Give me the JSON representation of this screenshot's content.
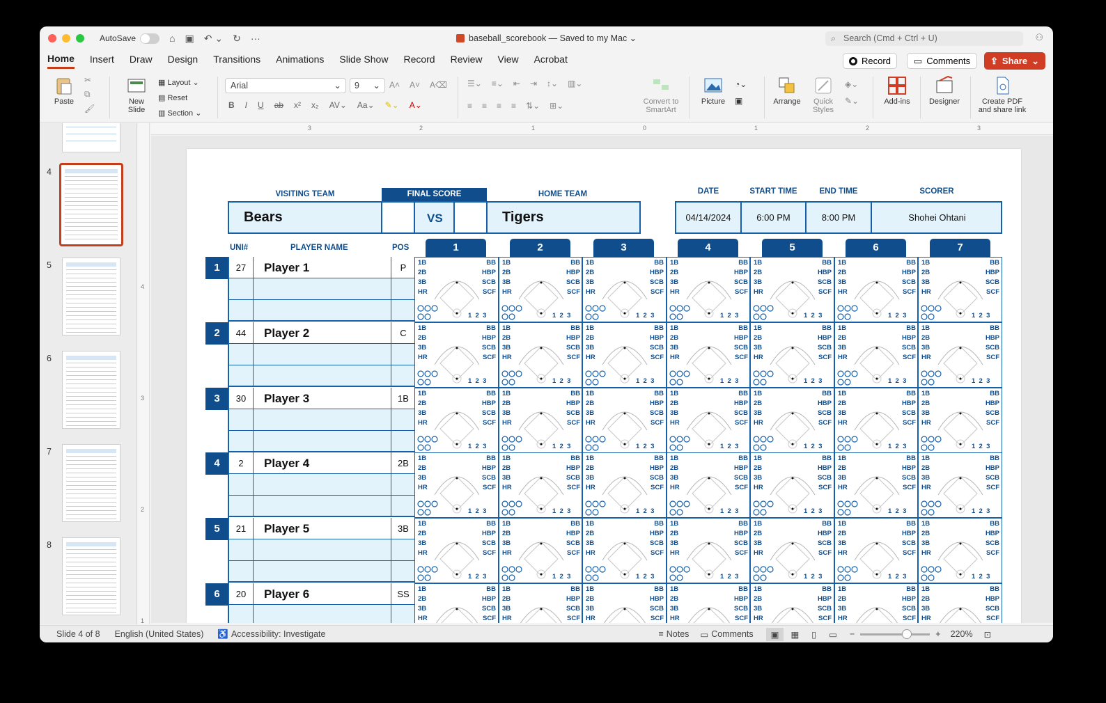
{
  "window": {
    "autosave_label": "AutoSave",
    "doc_title": "baseball_scorebook — Saved to my Mac ⌄",
    "search_placeholder": "Search (Cmd + Ctrl + U)"
  },
  "menu": {
    "tabs": [
      "Home",
      "Insert",
      "Draw",
      "Design",
      "Transitions",
      "Animations",
      "Slide Show",
      "Record",
      "Review",
      "View",
      "Acrobat"
    ],
    "record_label": "Record",
    "comments_label": "Comments",
    "share_label": "Share"
  },
  "ribbon": {
    "paste": "Paste",
    "new_slide": "New\nSlide",
    "layout": "Layout",
    "reset": "Reset",
    "section": "Section",
    "font": "Arial",
    "size": "9",
    "convert_smartart": "Convert to\nSmartArt",
    "picture": "Picture",
    "arrange": "Arrange",
    "quick_styles": "Quick\nStyles",
    "addins": "Add-ins",
    "designer": "Designer",
    "create_pdf": "Create PDF\nand share link"
  },
  "thumbs": [
    {
      "num": "4"
    },
    {
      "num": "5"
    },
    {
      "num": "6"
    },
    {
      "num": "7"
    },
    {
      "num": "8"
    }
  ],
  "ruler": {
    "h": [
      "3",
      "2",
      "1",
      "0",
      "1",
      "2",
      "3"
    ],
    "v": [
      "4",
      "3",
      "2",
      "1"
    ]
  },
  "scorebook": {
    "visiting_label": "VISITING TEAM",
    "final_score_label": "FINAL SCORE",
    "home_label": "HOME TEAM",
    "visiting_team": "Bears",
    "vs": "VS",
    "home_team": "Tigers",
    "date_label": "DATE",
    "start_label": "START TIME",
    "end_label": "END TIME",
    "scorer_label": "SCORER",
    "date": "04/14/2024",
    "start_time": "6:00 PM",
    "end_time": "8:00 PM",
    "scorer": "Shohei Ohtani",
    "uni_label": "UNI#",
    "player_label": "PLAYER NAME",
    "pos_label": "POS",
    "innings": [
      "1",
      "2",
      "3",
      "4",
      "5",
      "6",
      "7"
    ],
    "players": [
      {
        "order": "1",
        "uni": "27",
        "name": "Player 1",
        "pos": "P"
      },
      {
        "order": "2",
        "uni": "44",
        "name": "Player 2",
        "pos": "C"
      },
      {
        "order": "3",
        "uni": "30",
        "name": "Player 3",
        "pos": "1B"
      },
      {
        "order": "4",
        "uni": "2",
        "name": "Player 4",
        "pos": "2B"
      },
      {
        "order": "5",
        "uni": "21",
        "name": "Player 5",
        "pos": "3B"
      },
      {
        "order": "6",
        "uni": "20",
        "name": "Player 6",
        "pos": "SS"
      }
    ],
    "cell_left": [
      "1B",
      "2B",
      "3B",
      "HR"
    ],
    "cell_right": [
      "BB",
      "HBP",
      "SCB",
      "SCF"
    ],
    "cell_outs": "1  2  3"
  },
  "status": {
    "slide": "Slide 4 of 8",
    "language": "English (United States)",
    "accessibility": "Accessibility: Investigate",
    "notes": "Notes",
    "comments": "Comments",
    "zoom": "220%"
  },
  "colors": {
    "accent": "#0f4d8c",
    "cell_fill": "#e3f3fb",
    "share": "#d13c24"
  }
}
